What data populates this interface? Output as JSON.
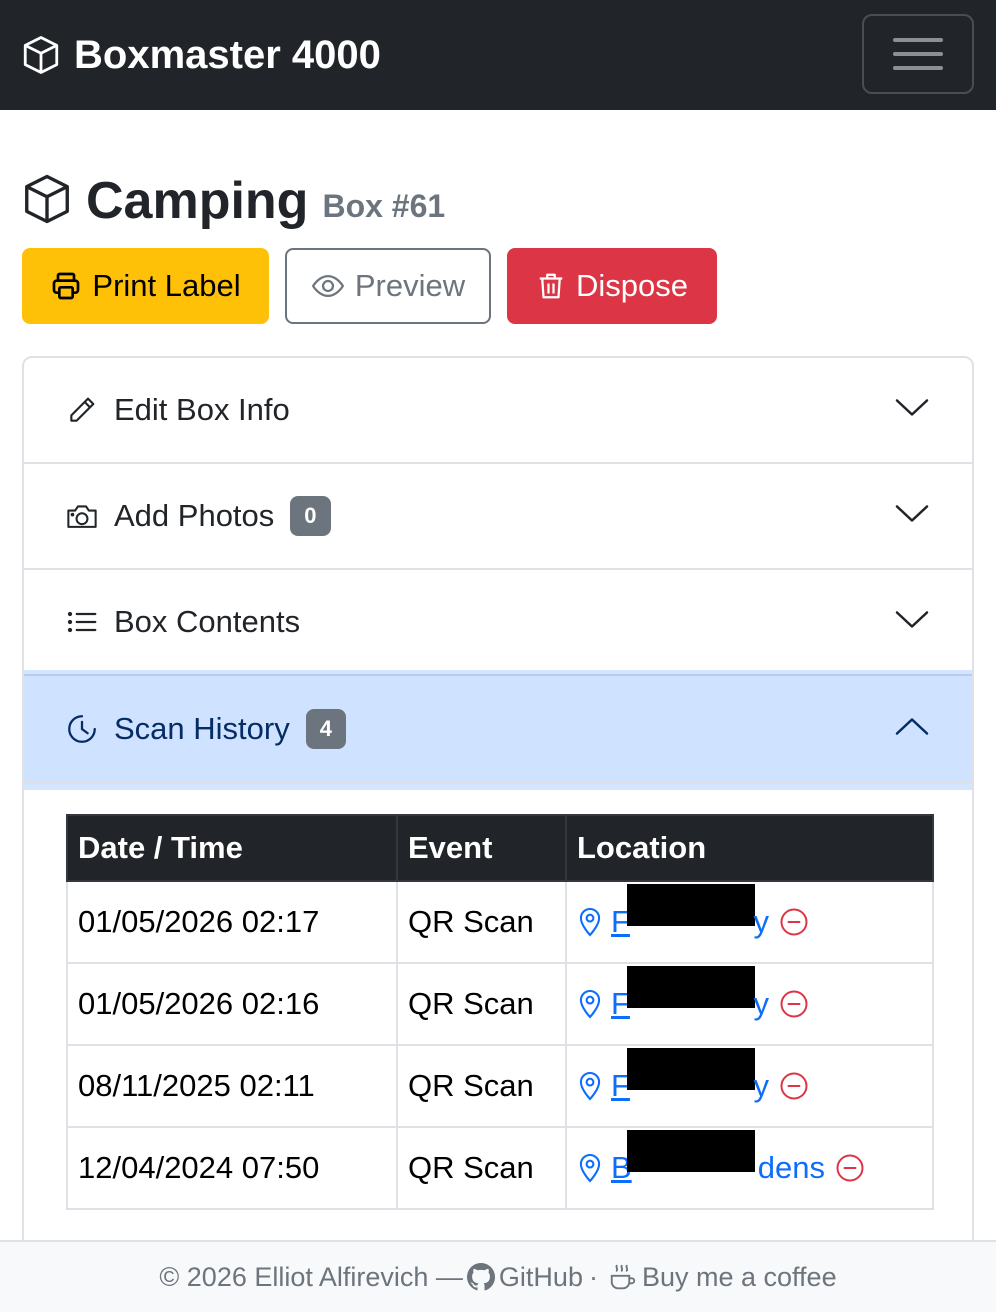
{
  "navbar": {
    "brand": "Boxmaster 4000",
    "menu_icon": "hamburger-icon"
  },
  "box": {
    "name": "Camping",
    "number": "Box #61"
  },
  "actions": {
    "print": "Print Label",
    "preview": "Preview",
    "dispose": "Dispose"
  },
  "accordion": {
    "edit": {
      "label": "Edit Box Info"
    },
    "photos": {
      "label": "Add Photos",
      "count": "0"
    },
    "contents": {
      "label": "Box Contents"
    },
    "history": {
      "label": "Scan History",
      "count": "4"
    }
  },
  "colors": {
    "primary": "#0d6efd",
    "warning": "#ffc107",
    "danger": "#dc3545",
    "dark": "#212529",
    "active_bg": "#cfe2ff"
  },
  "table": {
    "headers": [
      "Date / Time",
      "Event",
      "Location"
    ],
    "rows": [
      {
        "datetime": "01/05/2026 02:17",
        "event": "QR Scan",
        "location_start": "F",
        "location_end": "y"
      },
      {
        "datetime": "01/05/2026 02:16",
        "event": "QR Scan",
        "location_start": "F",
        "location_end": "y"
      },
      {
        "datetime": "08/11/2025 02:11",
        "event": "QR Scan",
        "location_start": "F",
        "location_end": "y"
      },
      {
        "datetime": "12/04/2024 07:50",
        "event": "QR Scan",
        "location_start": "B",
        "location_end": "dens"
      }
    ]
  },
  "footer": {
    "copyright": "© 2026 Elliot Alfirevich —",
    "github": "GitHub",
    "sep": "·",
    "coffee": "Buy me a coffee"
  }
}
